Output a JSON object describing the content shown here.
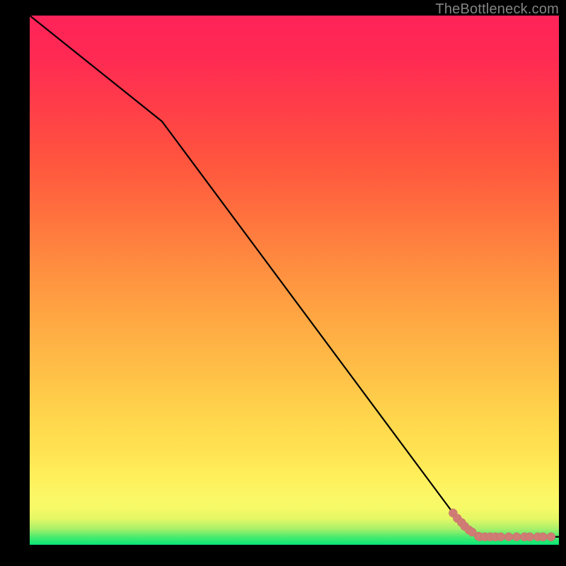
{
  "watermark": "TheBottleneck.com",
  "colors": {
    "line": "#000000",
    "marker_fill": "#cf7c75",
    "marker_stroke": "#c76e67"
  },
  "chart_data": {
    "type": "line",
    "title": "",
    "xlabel": "",
    "ylabel": "",
    "xlim": [
      0,
      100
    ],
    "ylim": [
      0,
      100
    ],
    "grid": false,
    "legend": false,
    "series": [
      {
        "name": "curve",
        "x": [
          0,
          25,
          80,
          85,
          100
        ],
        "y": [
          100,
          80,
          6,
          1.5,
          1.5
        ]
      }
    ],
    "markers": {
      "name": "highlight-points",
      "x": [
        80.0,
        80.8,
        81.6,
        82.2,
        83.0,
        83.6,
        84.8,
        85.0,
        86.0,
        87.0,
        88.0,
        89.0,
        90.5,
        92.0,
        93.5,
        94.5,
        96.0,
        97.0,
        98.5
      ],
      "y": [
        6.0,
        5.0,
        4.2,
        3.5,
        2.8,
        2.4,
        1.6,
        1.5,
        1.5,
        1.5,
        1.5,
        1.5,
        1.5,
        1.5,
        1.5,
        1.5,
        1.5,
        1.5,
        1.5
      ],
      "radius": 6
    }
  }
}
